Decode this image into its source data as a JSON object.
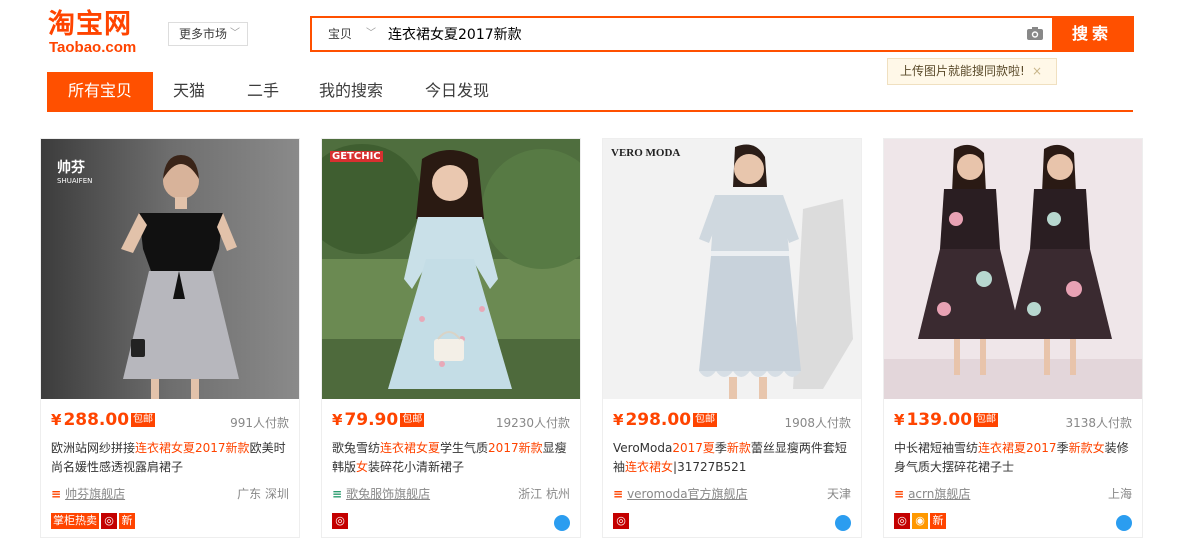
{
  "logo": {
    "cn": "淘宝网",
    "en": "Taobao.com"
  },
  "market": {
    "label": "更多市场"
  },
  "search": {
    "scope": "宝贝",
    "query": "连衣裙女夏2017新款",
    "button": "搜索"
  },
  "tip": {
    "text": "上传图片就能搜同款啦!",
    "close": "×"
  },
  "tabs": [
    {
      "label": "所有宝贝"
    },
    {
      "label": "天猫"
    },
    {
      "label": "二手"
    },
    {
      "label": "我的搜索"
    },
    {
      "label": "今日发现"
    }
  ],
  "products": [
    {
      "brand_text": "帅芬",
      "brand_sub": "SHUAIFEN",
      "price": "288.00",
      "baoyou": "包邮",
      "sales": "991人付款",
      "title_parts": [
        "欧洲站网纱拼接",
        "连衣裙女夏2017新款",
        "欧美时尚名媛性感透视露肩裙子"
      ],
      "shop": "帅芬旗舰店",
      "location": "广东 深圳",
      "badge_text": "掌柜热卖",
      "new_text": "新"
    },
    {
      "brand_text": "GETCHIC",
      "price": "79.90",
      "baoyou": "包邮",
      "sales": "19230人付款",
      "title_parts": [
        "歌兔雪纺",
        "连衣裙女夏",
        "学生气质",
        "2017新款",
        "显瘦韩版",
        "女",
        "装碎花小清新裙子"
      ],
      "shop": "歌兔服饰旗舰店",
      "location": "浙江 杭州"
    },
    {
      "brand_text": "VERO MODA",
      "price": "298.00",
      "baoyou": "包邮",
      "sales": "1908人付款",
      "title_parts": [
        "VeroModa",
        "2017夏",
        "季",
        "新款",
        "蕾丝显瘦两件套短袖",
        "连衣裙女",
        "|31727B521"
      ],
      "shop": "veromoda官方旗舰店",
      "location": "天津"
    },
    {
      "price": "139.00",
      "baoyou": "包邮",
      "sales": "3138人付款",
      "title_parts": [
        "中长裙短袖雪纺",
        "连衣裙夏2017",
        "季",
        "新款女",
        "装修身气质大摆碎花裙子士"
      ],
      "shop": "acrn旗舰店",
      "location": "上海",
      "new_text": "新"
    }
  ],
  "colors": {
    "accent": "#ff5000",
    "price": "#ff4400"
  },
  "icons": {
    "camera": "camera-icon",
    "wangwang": "wangwang-icon",
    "shop": "shop-icon"
  }
}
